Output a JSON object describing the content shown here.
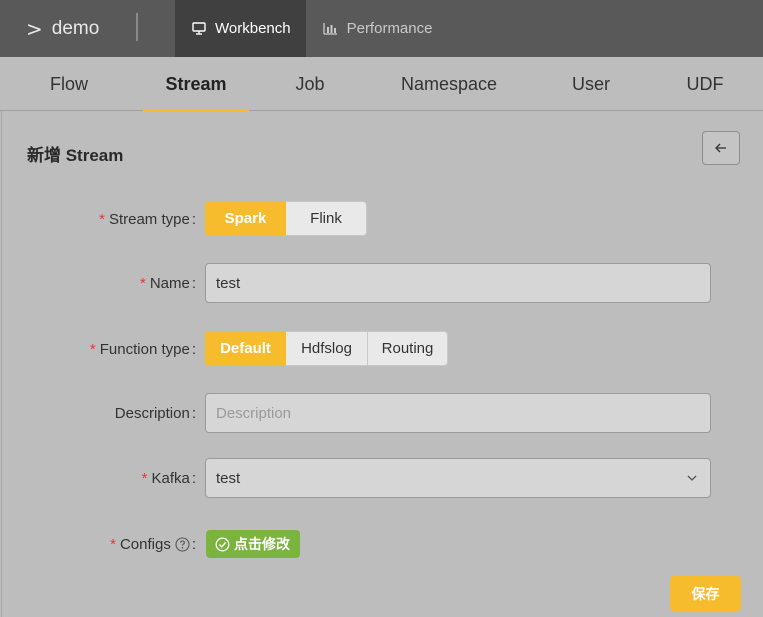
{
  "header": {
    "brand": "demo",
    "nav": [
      {
        "label": "Workbench",
        "icon": "desktop-icon",
        "active": true
      },
      {
        "label": "Performance",
        "icon": "bar-chart-icon",
        "active": false
      }
    ]
  },
  "tabs": [
    {
      "label": "Flow"
    },
    {
      "label": "Stream",
      "active": true
    },
    {
      "label": "Job"
    },
    {
      "label": "Namespace"
    },
    {
      "label": "User"
    },
    {
      "label": "UDF"
    }
  ],
  "page": {
    "title": "新增 Stream",
    "back_icon": "arrow-left-icon"
  },
  "form": {
    "stream_type": {
      "label": "Stream type",
      "required": "*",
      "options": [
        "Spark",
        "Flink"
      ],
      "selected": "Spark"
    },
    "name": {
      "label": "Name",
      "required": "*",
      "value": "test"
    },
    "function_type": {
      "label": "Function type",
      "required": "*",
      "options": [
        "Default",
        "Hdfslog",
        "Routing"
      ],
      "selected": "Default"
    },
    "description": {
      "label": "Description",
      "value": "",
      "placeholder": "Description"
    },
    "kafka": {
      "label": "Kafka",
      "required": "*",
      "value": "test"
    },
    "configs": {
      "label": "Configs",
      "required": "*",
      "button_label": "点击修改"
    },
    "colon": ":"
  },
  "actions": {
    "save_label": "保存"
  },
  "colors": {
    "accent": "#f7bc2d",
    "success": "#7bb33f",
    "required": "#e23b3b"
  }
}
